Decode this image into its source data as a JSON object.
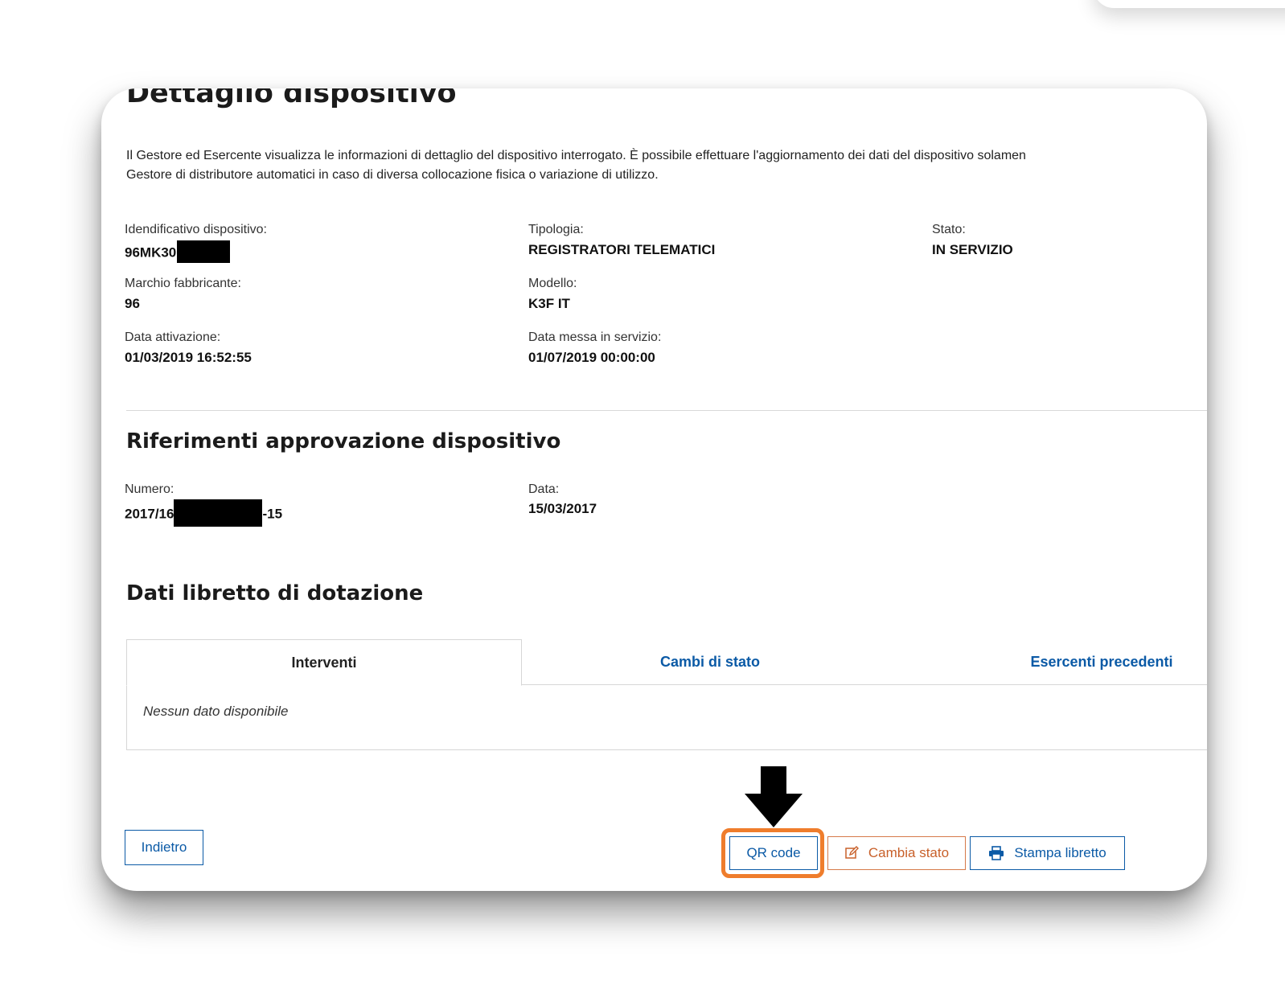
{
  "page": {
    "title": "Dettaglio dispositivo",
    "description_line1": "Il Gestore ed Esercente visualizza le informazioni di dettaglio del dispositivo interrogato. È possibile effettuare l'aggiornamento dei dati del dispositivo solamen",
    "description_line2": "Gestore di distributore automatici in caso di diversa collocazione fisica o variazione di utilizzo."
  },
  "device": {
    "id_label": "Idendificativo dispositivo:",
    "id_value": "96MK30",
    "type_label": "Tipologia:",
    "type_value": "REGISTRATORI TELEMATICI",
    "status_label": "Stato:",
    "status_value": "IN SERVIZIO",
    "brand_label": "Marchio fabbricante:",
    "brand_value": "96",
    "model_label": "Modello:",
    "model_value": "K3F IT",
    "activation_label": "Data attivazione:",
    "activation_value": "01/03/2019 16:52:55",
    "service_label": "Data messa in servizio:",
    "service_value": "01/07/2019 00:00:00"
  },
  "approval": {
    "title": "Riferimenti approvazione dispositivo",
    "number_label": "Numero:",
    "number_prefix": "2017/16",
    "number_suffix": "-15",
    "date_label": "Data:",
    "date_value": "15/03/2017"
  },
  "booklet": {
    "title": "Dati libretto di dotazione",
    "tabs": [
      {
        "label": "Interventi",
        "active": true
      },
      {
        "label": "Cambi di stato",
        "active": false
      },
      {
        "label": "Esercenti precedenti",
        "active": false
      }
    ],
    "empty_text": "Nessun dato disponibile"
  },
  "actions": {
    "back_label": "Indietro",
    "qr_label": "QR code",
    "change_status_label": "Cambia stato",
    "print_label": "Stampa libretto"
  },
  "colors": {
    "link_blue": "#0b5aa6",
    "warn_orange": "#c8602a",
    "highlight_orange": "#ef7d2c"
  },
  "icons": {
    "change_status": "edit-icon",
    "print": "printer-icon",
    "pointer": "down-arrow-icon"
  }
}
